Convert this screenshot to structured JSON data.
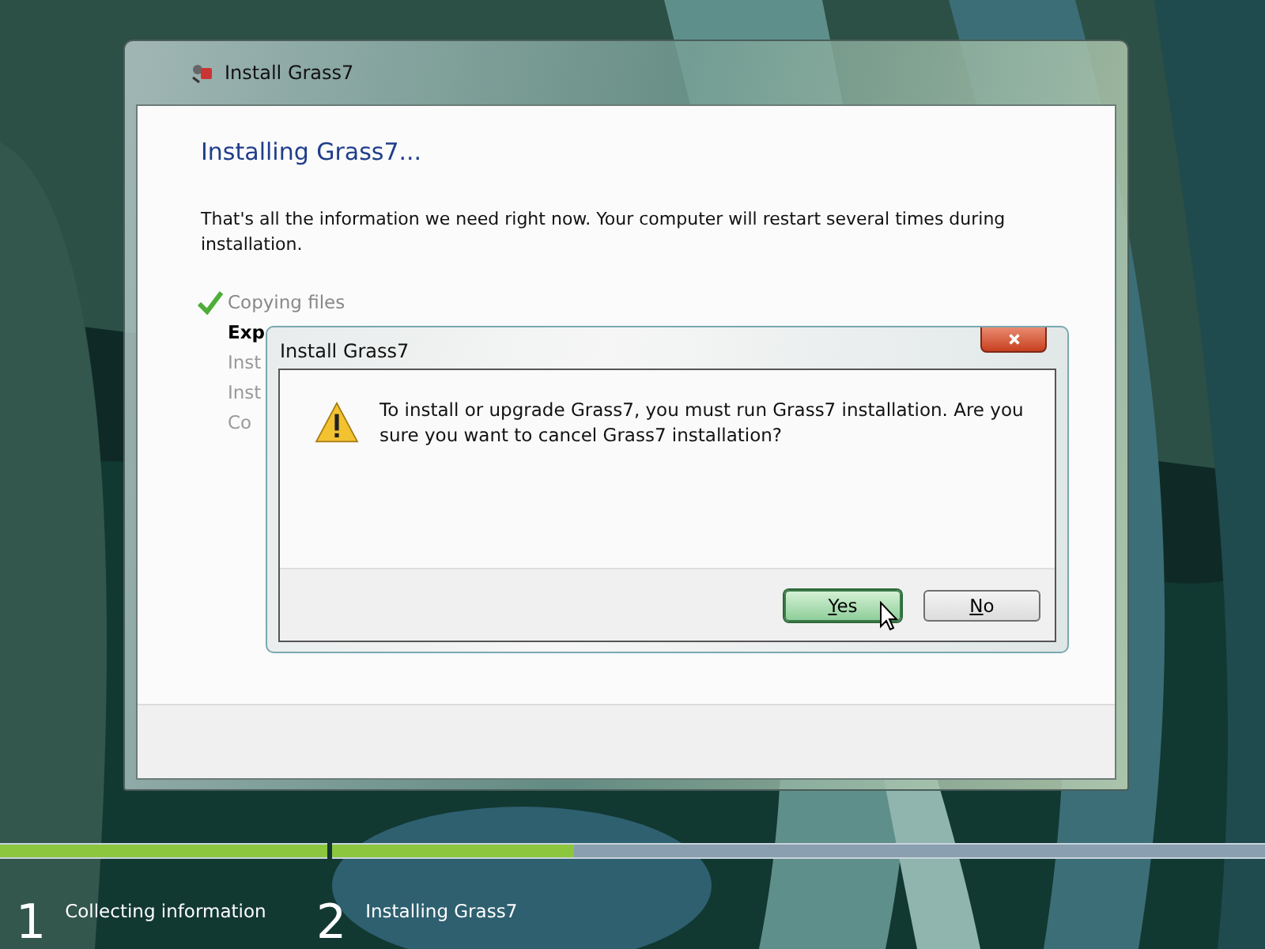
{
  "window": {
    "title": "Install Grass7",
    "heading": "Installing Grass7...",
    "message": "That's all the information we need right now. Your computer will restart several times during installation.",
    "steps": [
      {
        "label": "Copying files",
        "done": true,
        "current": false
      },
      {
        "label": "Exp",
        "done": false,
        "current": true
      },
      {
        "label": "Inst",
        "done": false,
        "current": false
      },
      {
        "label": "Inst",
        "done": false,
        "current": false
      },
      {
        "label": "Co",
        "done": false,
        "current": false
      }
    ]
  },
  "dialog": {
    "title": "Install Grass7",
    "message": "To install or upgrade Grass7, you must run Grass7 installation. Are you sure you want to cancel Grass7 installation?",
    "buttons": [
      {
        "label": "Yes",
        "default": true
      },
      {
        "label": "No",
        "default": false
      }
    ]
  },
  "progress": [
    {
      "number": "1",
      "label": "Collecting information",
      "level": 1
    },
    {
      "number": "2",
      "label": "Installing Grass7",
      "level": 0.26
    }
  ]
}
